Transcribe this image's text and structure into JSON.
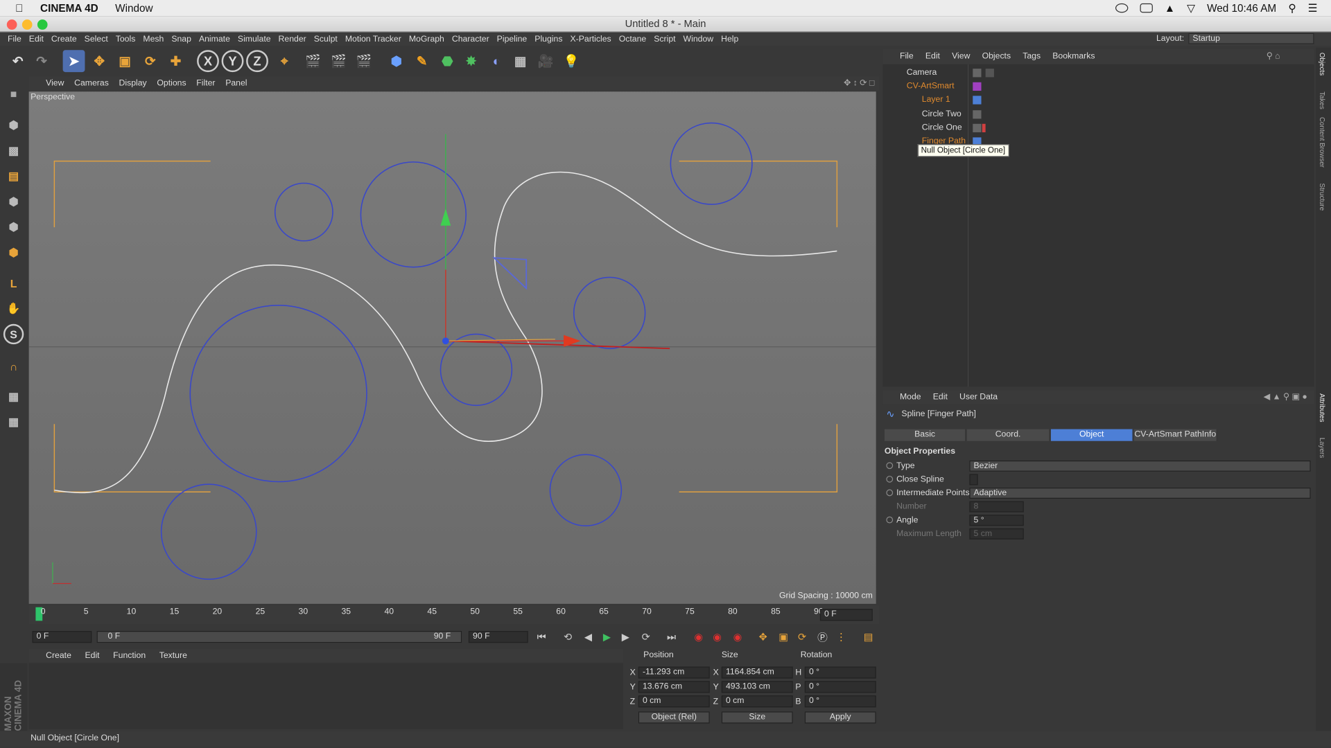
{
  "mac": {
    "app": "CINEMA 4D",
    "menu": [
      "Window"
    ],
    "clock": "Wed 10:46 AM"
  },
  "window": {
    "title": "Untitled 8 * - Main"
  },
  "menubar": [
    "File",
    "Edit",
    "Create",
    "Select",
    "Tools",
    "Mesh",
    "Snap",
    "Animate",
    "Simulate",
    "Render",
    "Sculpt",
    "Motion Tracker",
    "MoGraph",
    "Character",
    "Pipeline",
    "Plugins",
    "X-Particles",
    "Octane",
    "Script",
    "Window",
    "Help"
  ],
  "layout": {
    "label": "Layout:",
    "value": "Startup"
  },
  "toolbar": {
    "x": "X",
    "y": "Y",
    "z": "Z"
  },
  "viewport": {
    "menu": [
      "View",
      "Cameras",
      "Display",
      "Options",
      "Filter",
      "Panel"
    ],
    "label": "Perspective",
    "grid": "Grid Spacing : 10000 cm"
  },
  "timeline": {
    "ticks": [
      "0",
      "5",
      "10",
      "15",
      "20",
      "25",
      "30",
      "35",
      "40",
      "45",
      "50",
      "55",
      "60",
      "65",
      "70",
      "75",
      "80",
      "85",
      "90"
    ],
    "current": "0 F",
    "start": "0 F",
    "range_start": "0 F",
    "range_end": "90 F",
    "end": "90 F"
  },
  "material": {
    "menu": [
      "Create",
      "Edit",
      "Function",
      "Texture"
    ]
  },
  "coord": {
    "headers": {
      "position": "Position",
      "size": "Size",
      "rotation": "Rotation"
    },
    "rows": [
      {
        "axis": "X",
        "pos": "-11.293 cm",
        "saxis": "X",
        "size": "1164.854 cm",
        "raxis": "H",
        "rot": "0 °"
      },
      {
        "axis": "Y",
        "pos": "13.676 cm",
        "saxis": "Y",
        "size": "493.103 cm",
        "raxis": "P",
        "rot": "0 °"
      },
      {
        "axis": "Z",
        "pos": "0 cm",
        "saxis": "Z",
        "size": "0 cm",
        "raxis": "B",
        "rot": "0 °"
      }
    ],
    "mode": "Object (Rel)",
    "size_mode": "Size",
    "apply": "Apply"
  },
  "status": "Null Object [Circle One]",
  "maxon": "MAXON CINEMA 4D",
  "objects": {
    "menu": [
      "File",
      "Edit",
      "View",
      "Objects",
      "Tags",
      "Bookmarks"
    ],
    "items": [
      {
        "name": "Camera",
        "color": "#dddddd"
      },
      {
        "name": "CV-ArtSmart",
        "color": "#e08a2e"
      },
      {
        "name": "Layer 1",
        "color": "#e08a2e"
      },
      {
        "name": "Circle Two",
        "color": "#dddddd"
      },
      {
        "name": "Circle One",
        "color": "#dddddd"
      },
      {
        "name": "Finger Path",
        "color": "#e08a2e"
      }
    ],
    "tooltip": "Null Object [Circle One]"
  },
  "attributes": {
    "menu": [
      "Mode",
      "Edit",
      "User Data"
    ],
    "title": "Spline [Finger Path]",
    "tabs": [
      "Basic",
      "Coord.",
      "Object",
      "CV-ArtSmart PathInfo"
    ],
    "active_tab": "Object",
    "section": "Object Properties",
    "props": [
      {
        "label": "Type",
        "value": "Bezier"
      },
      {
        "label": "Close Spline",
        "value": ""
      },
      {
        "label": "Intermediate Points",
        "value": "Adaptive"
      },
      {
        "label": "Number",
        "value": "8"
      },
      {
        "label": "Angle",
        "value": "5 °"
      },
      {
        "label": "Maximum Length",
        "value": "5 cm"
      }
    ]
  },
  "right_tabs": [
    "Objects",
    "Takes",
    "Content Browser",
    "Structure",
    "Attributes",
    "Layers"
  ],
  "colors": {
    "accent": "#4d7fd6",
    "circle": "#3a48c8",
    "frame": "#e0a040",
    "spline": "#e8e8e8"
  }
}
